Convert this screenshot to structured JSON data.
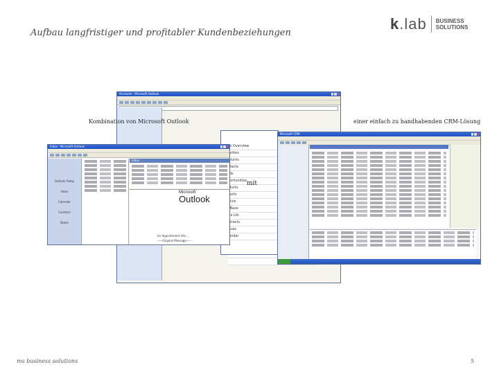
{
  "header": {
    "title": "Aufbau langfristiger und profitabler Kundenbeziehungen",
    "logo_mark_k": "k",
    "logo_mark_rest": ".lab",
    "logo_sub_line1": "BUSINESS",
    "logo_sub_line2": "SOLUTIONS"
  },
  "captions": {
    "left": "Kombination von Microsoft Outlook",
    "right": "einer einfach zu handhabenden CRM-Lösung",
    "mit": "mit"
  },
  "footer": {
    "left": "ms business solutions",
    "page": "5"
  },
  "windows": {
    "back_title": "Accounts - Microsoft Outlook",
    "inbox_title": "Inbox - Microsoft Outlook",
    "inbox_header": "Inbox",
    "crm_title": "Microsoft CRM",
    "outlook_logo_small": "Microsoft",
    "outlook_logo": "Outlook",
    "mail_preview_1": "Im Appointment Info ...",
    "mail_preview_2": "-----Original Message-----",
    "nav_items": [
      "Outlook Today",
      "Inbox",
      "Calendar",
      "Contacts",
      "Notes"
    ],
    "crm_sidebar": [
      "Case Overview",
      "Activities",
      "Accounts",
      "Contacts",
      "Leads",
      "Opportunities",
      "Products",
      "Reports",
      "Service",
      "Kn. Base",
      "Sales Litr.",
      "Contracts",
      "Queues",
      "Calendar"
    ]
  },
  "colors": {
    "title_bar": "#2453b8",
    "accent": "#4a70c0"
  }
}
